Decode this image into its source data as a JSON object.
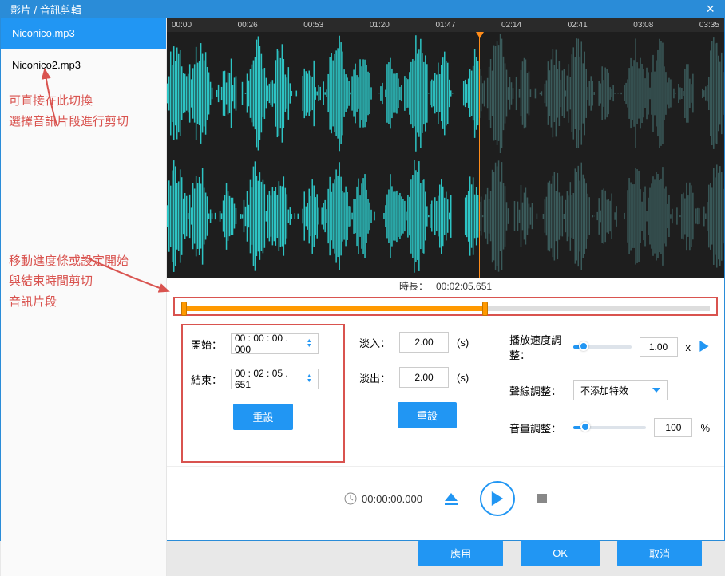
{
  "titlebar": {
    "title": "影片 / 音訊剪輯"
  },
  "sidebar": {
    "files": [
      {
        "name": "Niconico.mp3",
        "active": true
      },
      {
        "name": "Niconico2.mp3",
        "active": false
      }
    ],
    "annotation1": "可直接在此切換\n選擇音訊片段進行剪切",
    "annotation2": "移動進度條或設定開始\n與結束時間剪切\n音訊片段"
  },
  "ruler": [
    "00:00",
    "00:26",
    "00:53",
    "01:20",
    "01:47",
    "02:14",
    "02:41",
    "03:08",
    "03:35"
  ],
  "duration": {
    "label": "時長：",
    "value": "00:02:05.651"
  },
  "trim": {
    "start_label": "開始：",
    "start_value": "00 : 00 : 00 . 000",
    "end_label": "結束：",
    "end_value": "00 : 02 : 05 . 651",
    "reset": "重設"
  },
  "fade": {
    "in_label": "淡入：",
    "in_value": "2.00",
    "out_label": "淡出：",
    "out_value": "2.00",
    "unit": "(s)",
    "reset": "重設"
  },
  "right": {
    "speed_label": "播放速度調整：",
    "speed_value": "1.00",
    "speed_x": "x",
    "effect_label": "聲線調整：",
    "effect_value": "不添加特效",
    "volume_label": "音量調整：",
    "volume_value": "100",
    "volume_pct": "%"
  },
  "transport": {
    "time": "00:00:00.000"
  },
  "footer": {
    "apply": "應用",
    "ok": "OK",
    "cancel": "取消"
  }
}
